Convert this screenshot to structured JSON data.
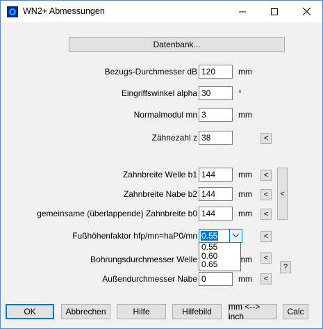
{
  "window": {
    "title": "WN2+ Abmessungen",
    "minimize": "—",
    "maximize": "☐",
    "close": "✕"
  },
  "db_button": "Datenbank...",
  "fields": [
    {
      "label": "Bezugs-Durchmesser dB",
      "value": "120",
      "unit": "mm"
    },
    {
      "label": "Eingriffswinkel alpha",
      "value": "30",
      "unit": "°"
    },
    {
      "label": "Normalmodul mn",
      "value": "3",
      "unit": "mm"
    },
    {
      "label": "Zähnezahl z",
      "value": "38",
      "unit": ""
    },
    {
      "label": "Zahnbreite Welle b1",
      "value": "144",
      "unit": "mm"
    },
    {
      "label": "Zahnbreite Nabe b2",
      "value": "144",
      "unit": "mm"
    },
    {
      "label": "gemeinsame (überlappende) Zahnbreite b0",
      "value": "144",
      "unit": "mm"
    },
    {
      "label": "Fußhöhenfaktor hfp/mn=haP0/mn",
      "value": "0.55",
      "unit": ""
    },
    {
      "label": "Bohrungsdurchmesser Welle",
      "value": "",
      "unit": "mm"
    },
    {
      "label": "Außendurchmesser Nabe",
      "value": "0",
      "unit": "mm"
    }
  ],
  "dropdown": {
    "options": [
      "0.55",
      "0.60",
      "0.65"
    ]
  },
  "side_buttons": {
    "arrow": "<",
    "help": "?"
  },
  "bottom_buttons": {
    "ok": "OK",
    "cancel": "Abbrechen",
    "help": "Hilfe",
    "helpimage": "Hilfebild",
    "unit_toggle": "mm <--> inch",
    "calc": "Calc"
  }
}
